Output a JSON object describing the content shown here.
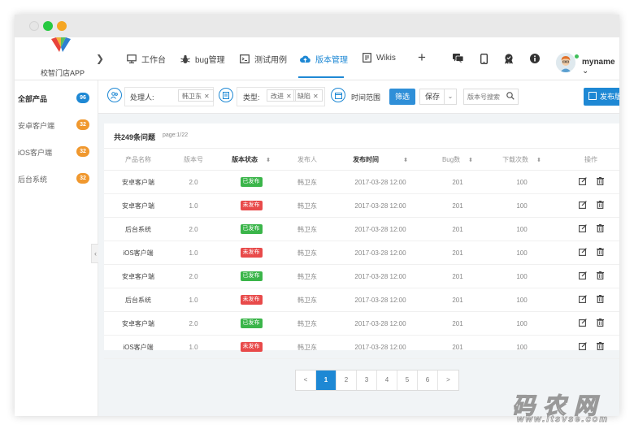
{
  "app": {
    "logo_text": "校智门店APP",
    "window_dots": [
      "#e8e8e8",
      "#27c941",
      "#f5a623"
    ]
  },
  "nav": {
    "items": [
      {
        "label": "工作台",
        "icon": "monitor-icon"
      },
      {
        "label": "bug管理",
        "icon": "bug-icon"
      },
      {
        "label": "测试用例",
        "icon": "terminal-icon"
      },
      {
        "label": "版本管理",
        "icon": "cloud-upload-icon",
        "active": true
      },
      {
        "label": "Wikis",
        "icon": "document-icon"
      }
    ],
    "plus": "+",
    "username": "myname"
  },
  "sidebar": {
    "items": [
      {
        "label": "全部产品",
        "count": "96",
        "color": "#1e88d4",
        "active": true
      },
      {
        "label": "安卓客户端",
        "count": "32",
        "color": "#f0982e"
      },
      {
        "label": "iOS客户端",
        "count": "32",
        "color": "#f0982e"
      },
      {
        "label": "后台系统",
        "count": "32",
        "color": "#f0982e"
      }
    ]
  },
  "filters": {
    "assignee_label": "处理人:",
    "assignee_tags": [
      "韩卫东"
    ],
    "type_label": "类型:",
    "type_tags": [
      "改进",
      "缺陷"
    ],
    "time_label": "时间范围",
    "filter_button": "筛选",
    "save_select": "保存",
    "search_placeholder": "版本号搜索",
    "publish_button": "发布版本"
  },
  "panel": {
    "title": "共249条问题",
    "page_info": "page:1/22"
  },
  "table": {
    "headers": [
      "产品名称",
      "版本号",
      "版本状态",
      "发布人",
      "发布时间",
      "Bug数",
      "下载次数",
      "操作"
    ],
    "rows": [
      {
        "name": "安卓客户端",
        "version": "2.0",
        "status": "已发布",
        "published": true,
        "publisher": "韩卫东",
        "time": "2017-03-28 12:00",
        "bugs": "201",
        "downloads": "100"
      },
      {
        "name": "安卓客户端",
        "version": "1.0",
        "status": "未发布",
        "published": false,
        "publisher": "韩卫东",
        "time": "2017-03-28 12:00",
        "bugs": "201",
        "downloads": "100"
      },
      {
        "name": "后台系统",
        "version": "2.0",
        "status": "已发布",
        "published": true,
        "publisher": "韩卫东",
        "time": "2017-03-28 12:00",
        "bugs": "201",
        "downloads": "100"
      },
      {
        "name": "iOS客户端",
        "version": "1.0",
        "status": "未发布",
        "published": false,
        "publisher": "韩卫东",
        "time": "2017-03-28 12:00",
        "bugs": "201",
        "downloads": "100"
      },
      {
        "name": "安卓客户端",
        "version": "2.0",
        "status": "已发布",
        "published": true,
        "publisher": "韩卫东",
        "time": "2017-03-28 12:00",
        "bugs": "201",
        "downloads": "100"
      },
      {
        "name": "后台系统",
        "version": "1.0",
        "status": "未发布",
        "published": false,
        "publisher": "韩卫东",
        "time": "2017-03-28 12:00",
        "bugs": "201",
        "downloads": "100"
      },
      {
        "name": "安卓客户端",
        "version": "2.0",
        "status": "已发布",
        "published": true,
        "publisher": "韩卫东",
        "time": "2017-03-28 12:00",
        "bugs": "201",
        "downloads": "100"
      },
      {
        "name": "iOS客户端",
        "version": "1.0",
        "status": "未发布",
        "published": false,
        "publisher": "韩卫东",
        "time": "2017-03-28 12:00",
        "bugs": "201",
        "downloads": "100"
      }
    ],
    "status_colors": {
      "published": "#3bb54a",
      "unpublished": "#e84a4a"
    }
  },
  "pagination": {
    "prev": "<",
    "pages": [
      "1",
      "2",
      "3",
      "4",
      "5",
      "6"
    ],
    "active": "1",
    "next": ">"
  },
  "watermark": {
    "main": "码农网",
    "sub": "www.itsvse.com"
  }
}
